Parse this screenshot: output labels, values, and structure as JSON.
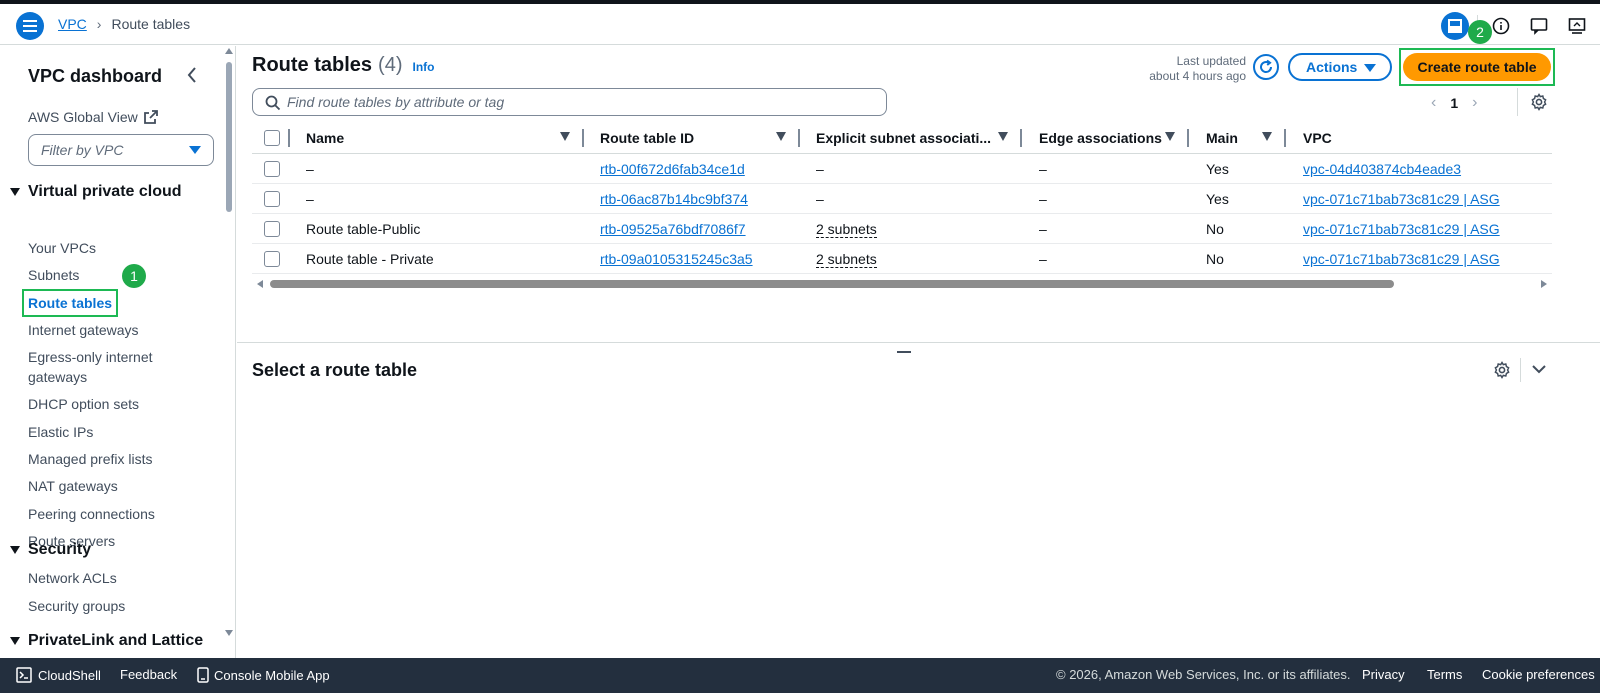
{
  "header": {
    "breadcrumb": [
      "VPC",
      "Route tables"
    ]
  },
  "sidebar": {
    "title": "VPC dashboard",
    "global_view": "AWS Global View",
    "filter_placeholder": "Filter by VPC",
    "sections": [
      {
        "label": "Virtual private cloud",
        "items": [
          "Your VPCs",
          "Subnets",
          "Route tables",
          "Internet gateways",
          "Egress-only internet gateways",
          "DHCP option sets",
          "Elastic IPs",
          "Managed prefix lists",
          "NAT gateways",
          "Peering connections",
          "Route servers"
        ]
      },
      {
        "label": "Security",
        "items": [
          "Network ACLs",
          "Security groups"
        ]
      },
      {
        "label": "PrivateLink and Lattice",
        "items": []
      }
    ],
    "active_item": "Route tables",
    "callout_1": "1"
  },
  "main": {
    "title": "Route tables",
    "count": "(4)",
    "info": "Info",
    "last_updated_label": "Last updated",
    "last_updated_value": "about 4 hours ago",
    "actions_label": "Actions",
    "create_label": "Create route table",
    "callout_2": "2",
    "search_placeholder": "Find route tables by attribute or tag",
    "page": "1",
    "columns": [
      "Name",
      "Route table ID",
      "Explicit subnet associati...",
      "Edge associations",
      "Main",
      "VPC"
    ],
    "rows": [
      {
        "name": "–",
        "id": "rtb-00f672d6fab34ce1d",
        "subnets": "–",
        "edge": "–",
        "main": "Yes",
        "vpc": "vpc-04d403874cb4eade3"
      },
      {
        "name": "–",
        "id": "rtb-06ac87b14bc9bf374",
        "subnets": "–",
        "edge": "–",
        "main": "Yes",
        "vpc": "vpc-071c71bab73c81c29 | ASG"
      },
      {
        "name": "Route table-Public",
        "id": "rtb-09525a76bdf7086f7",
        "subnets": "2 subnets",
        "edge": "–",
        "main": "No",
        "vpc": "vpc-071c71bab73c81c29 | ASG"
      },
      {
        "name": "Route table - Private",
        "id": "rtb-09a0105315245c3a5",
        "subnets": "2 subnets",
        "edge": "–",
        "main": "No",
        "vpc": "vpc-071c71bab73c81c29 | ASG"
      }
    ],
    "detail_title": "Select a route table"
  },
  "footer": {
    "cloudshell": "CloudShell",
    "feedback": "Feedback",
    "mobile_app": "Console Mobile App",
    "copyright": "© 2026, Amazon Web Services, Inc. or its affiliates.",
    "privacy": "Privacy",
    "terms": "Terms",
    "cookie": "Cookie preferences"
  },
  "colors": {
    "accent": "#0972d3",
    "primary_button": "#ff9900",
    "highlight": "#1db954",
    "footer_bg": "#232f3e"
  }
}
